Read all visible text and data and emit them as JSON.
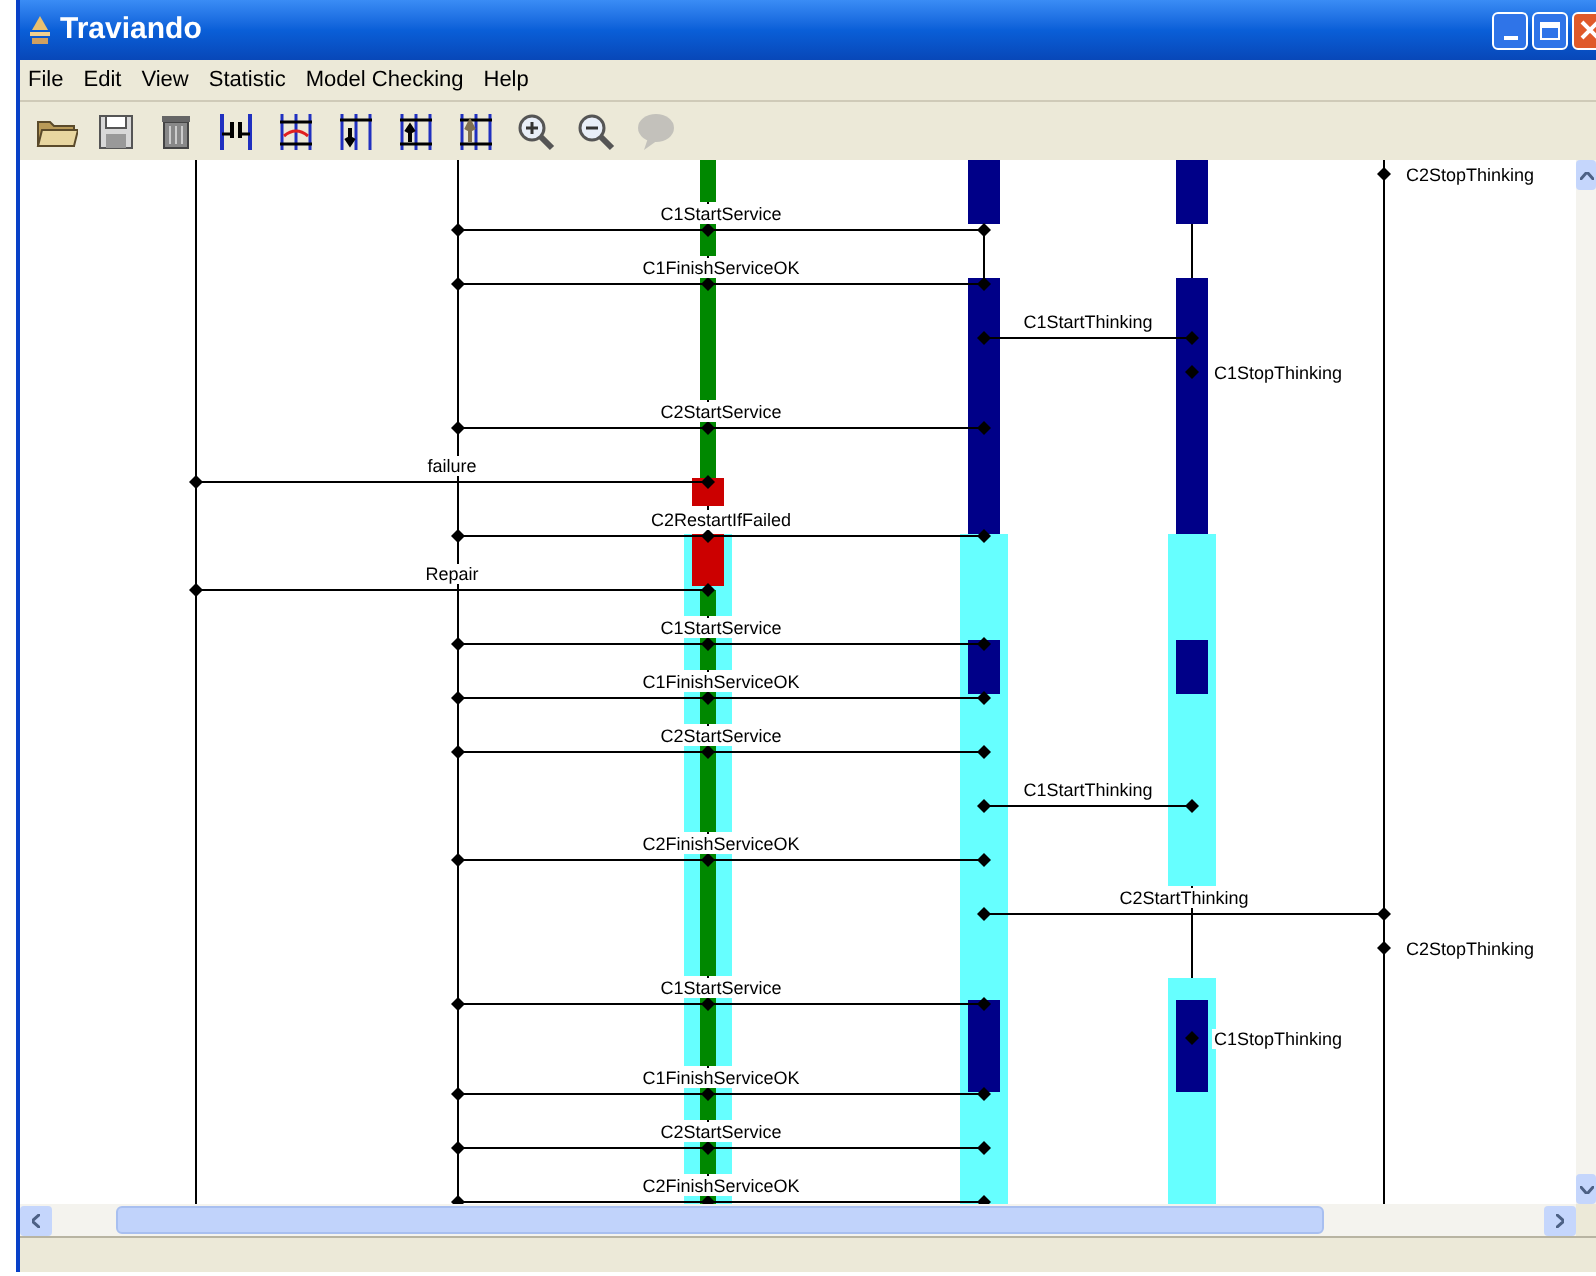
{
  "window": {
    "title": "Traviando"
  },
  "menu": [
    "File",
    "Edit",
    "View",
    "Statistic",
    "Model Checking",
    "Help"
  ],
  "toolbar": [
    {
      "kind": "open",
      "disabled": false
    },
    {
      "kind": "save",
      "disabled": false
    },
    {
      "kind": "delete",
      "disabled": false
    },
    {
      "kind": "merge",
      "disabled": false
    },
    {
      "kind": "loop",
      "disabled": false
    },
    {
      "kind": "down",
      "disabled": false
    },
    {
      "kind": "up",
      "disabled": false
    },
    {
      "kind": "top",
      "disabled": false
    },
    {
      "kind": "zoom-in",
      "disabled": false
    },
    {
      "kind": "zoom-out",
      "disabled": false
    },
    {
      "kind": "comment",
      "disabled": true
    }
  ],
  "diagram": {
    "events": [
      {
        "kind": "wait-end",
        "label": "C2StopThinking"
      },
      {
        "kind": "service",
        "label": "C1StartService"
      },
      {
        "kind": "service",
        "label": "C1FinishServiceOK"
      },
      {
        "kind": "think",
        "label": "C1StartThinking"
      },
      {
        "kind": "think-end",
        "label": "C1StopThinking"
      },
      {
        "kind": "service",
        "label": "C2StartService"
      },
      {
        "kind": "fault",
        "label": "failure"
      },
      {
        "kind": "service",
        "label": "C2RestartIfFailed"
      },
      {
        "kind": "fault",
        "label": "Repair"
      },
      {
        "kind": "service",
        "label": "C1StartService"
      },
      {
        "kind": "service",
        "label": "C1FinishServiceOK"
      },
      {
        "kind": "service",
        "label": "C2StartService"
      },
      {
        "kind": "think",
        "label": "C1StartThinking"
      },
      {
        "kind": "service",
        "label": "C2FinishServiceOK"
      },
      {
        "kind": "wait",
        "label": "C2StartThinking"
      },
      {
        "kind": "wait-end",
        "label": "C2StopThinking"
      },
      {
        "kind": "service",
        "label": "C1StartService"
      },
      {
        "kind": "think-end",
        "label": "C1StopThinking"
      },
      {
        "kind": "service",
        "label": "C1FinishServiceOK"
      },
      {
        "kind": "service",
        "label": "C2StartService"
      },
      {
        "kind": "service",
        "label": "C2FinishServiceOK"
      }
    ]
  }
}
